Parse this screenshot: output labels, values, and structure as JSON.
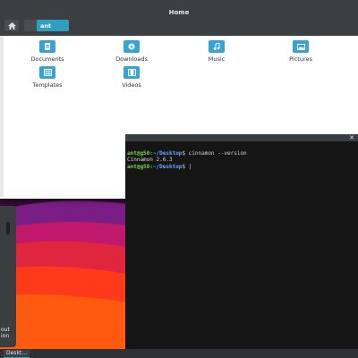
{
  "file_manager": {
    "title": "Home",
    "breadcrumb": "ant",
    "items": [
      {
        "label": "Documents",
        "icon": "documents-folder-icon"
      },
      {
        "label": "Downloads",
        "icon": "downloads-folder-icon"
      },
      {
        "label": "Music",
        "icon": "music-folder-icon"
      },
      {
        "label": "Pictures",
        "icon": "pictures-folder-icon"
      },
      {
        "label": "Templates",
        "icon": "templates-folder-icon"
      },
      {
        "label": "Videos",
        "icon": "videos-folder-icon"
      }
    ]
  },
  "terminal": {
    "line1_user": "ant@g50:",
    "line1_path": "~/Desktop",
    "line1_cmd": "$ cinnamon --version",
    "line2_output": "Cinnamon 2.6.3",
    "line3_user": "ant@g50:",
    "line3_path": "~/Desktop",
    "line3_cmd": "$ |"
  },
  "side_panel": {
    "text_line1": "out",
    "text_line2": "ion"
  },
  "taskbar": {
    "active_task": "Deskt…"
  },
  "colors": {
    "accent": "#2f9fbf",
    "folder_icon": "#36a3d4",
    "prompt_user": "#7bd34a",
    "prompt_path": "#6aa2ff"
  }
}
